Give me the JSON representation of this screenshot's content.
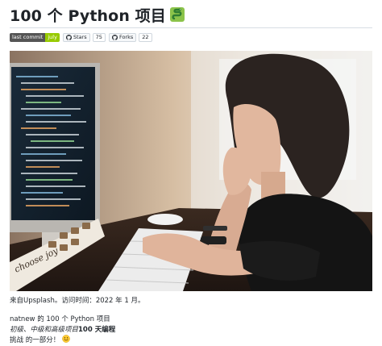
{
  "header": {
    "title": "100 个 Python 项目",
    "title_icon": "snake-emoji"
  },
  "badges": {
    "last_commit": {
      "label": "last commit",
      "value": "july",
      "color": "#97ca00"
    },
    "stars": {
      "label": "Stars",
      "count": "75",
      "icon": "github-icon"
    },
    "forks": {
      "label": "Forks",
      "count": "22",
      "icon": "github-icon"
    }
  },
  "image": {
    "description_icon": "photo-woman-coding"
  },
  "caption": "来自Upsplash。访问时间：2022 年 1 月。",
  "body": {
    "line1": "natnew 的 100 个 Python 项目",
    "line2_italic": "初级、中级和高级项目",
    "line2_bold": "100 天编程",
    "line3": "挑战 的一部分！",
    "line3_icon": "smiley-emoji"
  }
}
